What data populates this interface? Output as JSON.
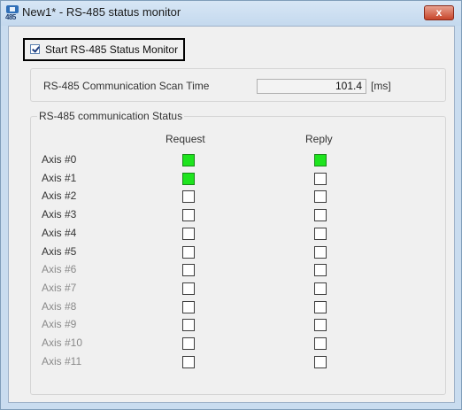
{
  "window": {
    "title": "New1* - RS-485 status monitor",
    "icon_text": "485",
    "close_label": "x"
  },
  "monitor": {
    "label": "Start RS-485 Status Monitor",
    "checked": true
  },
  "scan_time": {
    "label": "RS-485 Communication Scan Time",
    "value": "101.4",
    "unit": "[ms]"
  },
  "status": {
    "group_title": "RS-485 communication Status",
    "request_header": "Request",
    "reply_header": "Reply",
    "active_color": "#1ee41e",
    "axes": [
      {
        "label": "Axis #0",
        "request": true,
        "reply": true,
        "label_color": "#333333"
      },
      {
        "label": "Axis #1",
        "request": true,
        "reply": false,
        "label_color": "#333333"
      },
      {
        "label": "Axis #2",
        "request": false,
        "reply": false,
        "label_color": "#333333"
      },
      {
        "label": "Axis #3",
        "request": false,
        "reply": false,
        "label_color": "#333333"
      },
      {
        "label": "Axis #4",
        "request": false,
        "reply": false,
        "label_color": "#333333"
      },
      {
        "label": "Axis #5",
        "request": false,
        "reply": false,
        "label_color": "#333333"
      },
      {
        "label": "Axis #6",
        "request": false,
        "reply": false,
        "label_color": "#8a8a8a"
      },
      {
        "label": "Axis #7",
        "request": false,
        "reply": false,
        "label_color": "#8a8a8a"
      },
      {
        "label": "Axis #8",
        "request": false,
        "reply": false,
        "label_color": "#8a8a8a"
      },
      {
        "label": "Axis #9",
        "request": false,
        "reply": false,
        "label_color": "#8a8a8a"
      },
      {
        "label": "Axis #10",
        "request": false,
        "reply": false,
        "label_color": "#8a8a8a"
      },
      {
        "label": "Axis #11",
        "request": false,
        "reply": false,
        "label_color": "#8a8a8a"
      }
    ]
  }
}
